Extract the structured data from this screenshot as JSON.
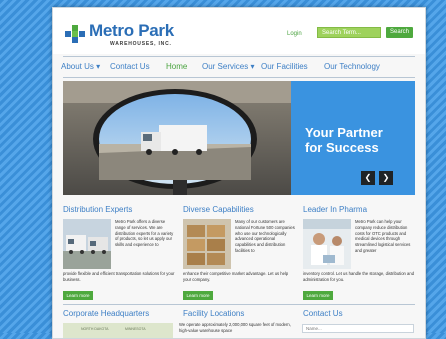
{
  "brand": {
    "name": "Metro Park",
    "tagline": "WAREHOUSES, INC."
  },
  "header": {
    "login": "Login",
    "search_placeholder": "Search Term...",
    "search_button": "Search"
  },
  "nav": {
    "items": [
      "About Us ▾",
      "Contact Us",
      "Home",
      "Our Services ▾",
      "Our Facilities",
      "Our Technology"
    ]
  },
  "hero": {
    "title_line1": "Your Partner",
    "title_line2": "for Success",
    "prev": "❮",
    "next": "❯"
  },
  "features": [
    {
      "title": "Distribution Experts",
      "text_side": "Metro Park offers a diverse range of services. We are distribution experts for a variety of products, so let us apply our skills and experience to",
      "text_full": "provide flexible and efficient transportation solutions for your business.",
      "button": "Learn more"
    },
    {
      "title": "Diverse Capabilities",
      "text_side": "Many of our customers are national Fortune 500 companies who use our technologically advanced operational capabilities and distribution facilities to",
      "text_full": "enhance their competitive market advantage. Let us help your company.",
      "button": "Learn more"
    },
    {
      "title": "Leader In Pharma",
      "text_side": "Metro Park can help your company reduce distribution costs for OTC products and medical devices through streamlined logistical services and greater",
      "text_full": "inventory control. Let us handle the storage, distribution and administration for you.",
      "button": "Learn more"
    }
  ],
  "bottom": {
    "hq_title": "Corporate Headquarters",
    "map_labels": [
      "NORTH DAKOTA",
      "MINNESOTA"
    ],
    "facilities_title": "Facility Locations",
    "facilities_text": "We operate approximately 2,000,000 square feet of modern, high-value warehouse space",
    "contact_title": "Contact Us",
    "name_placeholder": "Name..."
  },
  "colors": {
    "brand_blue": "#2b6eb6",
    "accent_green": "#4ea93e",
    "hero_blue": "#3a93e0"
  }
}
